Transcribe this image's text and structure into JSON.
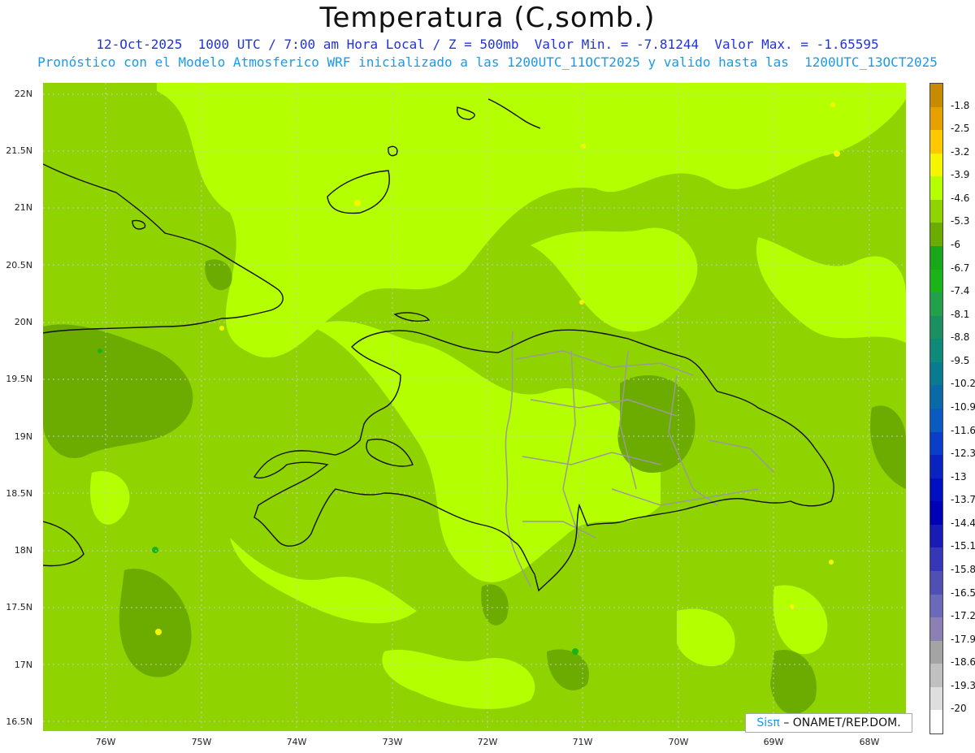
{
  "header": {
    "title": "Temperatura (C,somb.)",
    "line1": "12-Oct-2025  1000 UTC / 7:00 am Hora Local / Z = 500mb  Valor Min. = -7.81244  Valor Max. = -1.65595",
    "line2": "Pronóstico con el Modelo Atmosferico WRF inicializado a las 1200UTC_11OCT2025 y valido hasta las  1200UTC_13OCT2025"
  },
  "lat_labels": [
    "22N",
    "21.5N",
    "21N",
    "20.5N",
    "20N",
    "19.5N",
    "19N",
    "18.5N",
    "18N",
    "17.5N",
    "17N",
    "16.5N"
  ],
  "lon_labels": [
    "76W",
    "75W",
    "74W",
    "73W",
    "72W",
    "71W",
    "70W",
    "69W",
    "68W"
  ],
  "legend": {
    "labels": [
      "-1.8",
      "-2.5",
      "-3.2",
      "-3.9",
      "-4.6",
      "-5.3",
      "-6",
      "-6.7",
      "-7.4",
      "-8.1",
      "-8.8",
      "-9.5",
      "-10.2",
      "-10.9",
      "-11.6",
      "-12.3",
      "-13",
      "-13.7",
      "-14.4",
      "-15.1",
      "-15.8",
      "-16.5",
      "-17.2",
      "-17.9",
      "-18.6",
      "-19.3",
      "-20"
    ],
    "colors": [
      "#c88a00",
      "#e6a000",
      "#ffc800",
      "#f5f500",
      "#b4ff00",
      "#8fd400",
      "#6cac00",
      "#1aa81a",
      "#1ab41a",
      "#22a04a",
      "#1a9060",
      "#108a78",
      "#0a7a90",
      "#0a6aa8",
      "#0a5ac0",
      "#0a3ec8",
      "#0a22c0",
      "#0010c0",
      "#0000b4",
      "#1a1ab4",
      "#3636b8",
      "#5050b4",
      "#6a6ab8",
      "#8a80b4",
      "#a4a4a4",
      "#c0c0c0",
      "#dedede",
      "#ffffff"
    ]
  },
  "credit": {
    "brand": "Sisπ",
    "text": "– ONAMET/REP.DOM."
  },
  "chart_data": {
    "type": "heatmap",
    "title": "Temperatura (C,somb.)",
    "min": -7.81244,
    "max": -1.65595,
    "lat_range": [
      16.5,
      22
    ],
    "lon_range": [
      -76,
      -68
    ]
  }
}
